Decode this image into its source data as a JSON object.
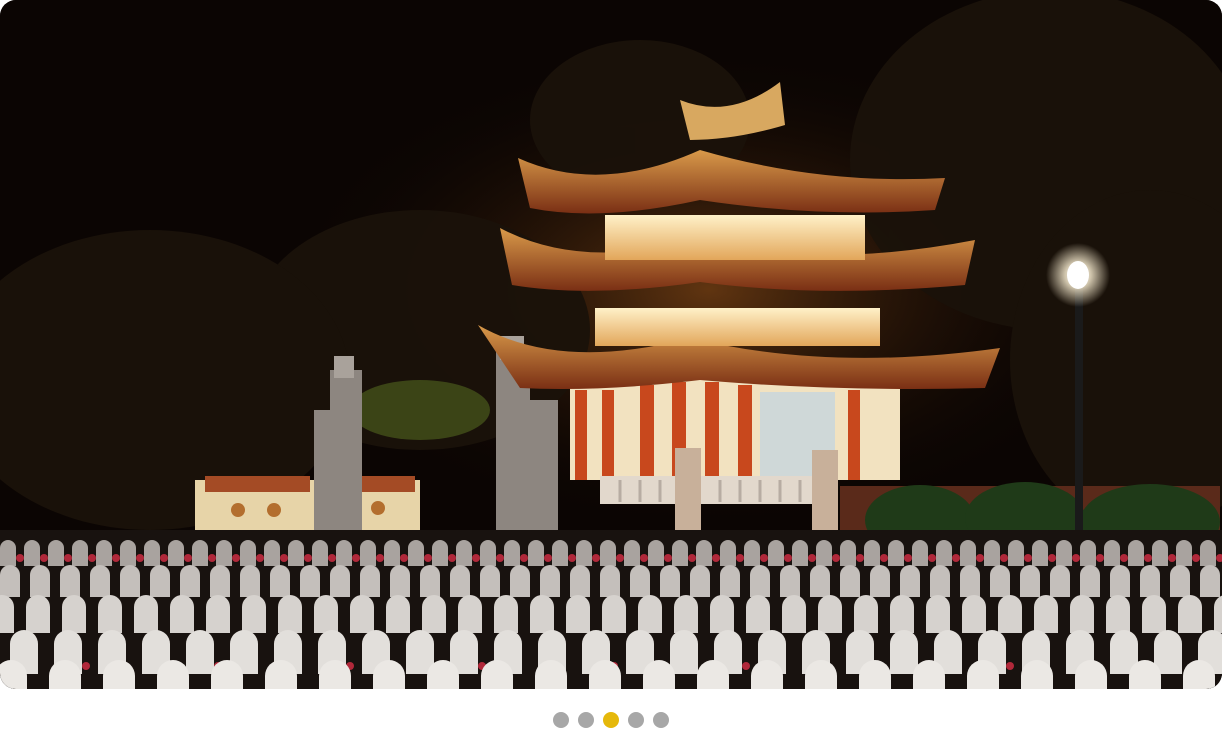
{
  "carousel": {
    "slide_description_hidden": "",
    "total_slides": 5,
    "active_index": 2
  },
  "colors": {
    "active_dot": "#e5b80b",
    "inactive_dot": "#a7a7a7",
    "sky": "#0b0503",
    "roof": "#8c3a1c",
    "lantern_glow": "#ffe9b0"
  },
  "icons": [
    "pagination-dot"
  ]
}
